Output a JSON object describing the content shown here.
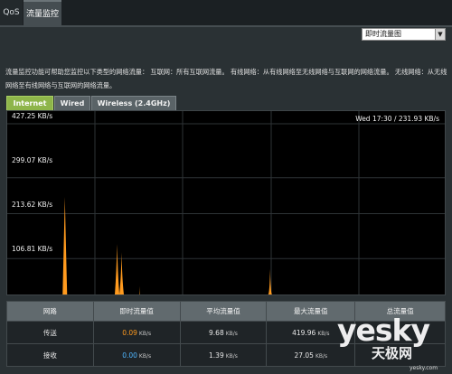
{
  "top_tabs": [
    {
      "label": "QoS"
    },
    {
      "label": "流量监控"
    }
  ],
  "view_select": {
    "value": "即时流量图"
  },
  "description": "流量监控功能可帮助您监控以下类型的网络流量： 互联网：所有互联网流量。 有线网络：从有线网络至无线网络与互联网的网络流量。 无线网络：从无线网络至有线网络与互联网的网络流量。",
  "chart_tabs": [
    {
      "label": "Internet",
      "active": true
    },
    {
      "label": "Wired",
      "active": false
    },
    {
      "label": "Wireless (2.4GHz)",
      "active": false
    }
  ],
  "readout": "Wed 17:30 / 231.93 KB/s",
  "chart_data": {
    "type": "area",
    "title": "",
    "xlabel": "",
    "ylabel": "",
    "ylim": [
      0,
      427.25
    ],
    "y_ticks": [
      "427.25 KB/s",
      "299.07 KB/s",
      "213.62 KB/s",
      "106.81 KB/s"
    ],
    "y_tick_values": [
      427.25,
      299.07,
      213.62,
      106.81
    ],
    "x_range": [
      0,
      480
    ],
    "grid": true,
    "color": "#ff9a1e",
    "spikes": [
      {
        "x": 60,
        "value": 232
      },
      {
        "x": 118,
        "value": 120
      },
      {
        "x": 123,
        "value": 100
      },
      {
        "x": 143,
        "value": 20
      },
      {
        "x": 288,
        "value": 61
      }
    ]
  },
  "stats": {
    "headers": [
      "网路",
      "即时流量值",
      "平均流量值",
      "最大流量值",
      "总流量值"
    ],
    "rows": [
      {
        "name": "传送",
        "now": "0.09",
        "now_unit": "KB/s",
        "avg": "9.68",
        "avg_unit": "KB/s",
        "max": "419.96",
        "max_unit": "KB/s",
        "total": "",
        "total_unit": ""
      },
      {
        "name": "接收",
        "now": "0.00",
        "now_unit": "KB/s",
        "avg": "1.39",
        "avg_unit": "KB/s",
        "max": "27.05",
        "max_unit": "KB/s",
        "total": "",
        "total_unit": ""
      }
    ]
  },
  "watermark": {
    "brand": "yesky",
    "sub": "天极网",
    "url": "yesky.com"
  }
}
